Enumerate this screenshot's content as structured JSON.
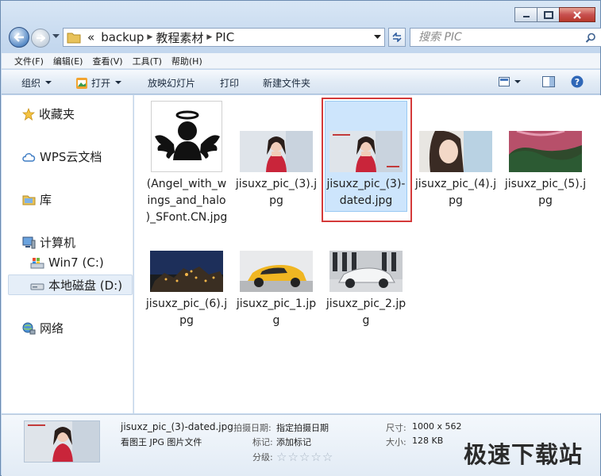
{
  "address": {
    "overflow": "«",
    "crumbs": [
      "backup",
      "教程素材",
      "PIC"
    ]
  },
  "search": {
    "placeholder": "搜索 PIC"
  },
  "menu": [
    "文件(F)",
    "编辑(E)",
    "查看(V)",
    "工具(T)",
    "帮助(H)"
  ],
  "commands": {
    "organize": "组织",
    "open": "打开",
    "slideshow": "放映幻灯片",
    "print": "打印",
    "new_folder": "新建文件夹"
  },
  "nav": {
    "favorites": "收藏夹",
    "wps_cloud": "WPS云文档",
    "libraries": "库",
    "computer": "计算机",
    "win7": "Win7 (C:)",
    "local_disk": "本地磁盘 (D:)",
    "network": "网络"
  },
  "files": [
    {
      "name": "(Angel_with_wings_and_halo)_SFont.CN.jpg",
      "icon": "angel-icon"
    },
    {
      "name": "jisuxz_pic_(3).jpg",
      "icon": "woman-portrait-photo"
    },
    {
      "name": "jisuxz_pic_(3)-dated.jpg",
      "icon": "woman-portrait-photo",
      "selected": true
    },
    {
      "name": "jisuxz_pic_(4).jpg",
      "icon": "woman-closeup-photo"
    },
    {
      "name": "jisuxz_pic_(5).jpg",
      "icon": "aerial-landscape-photo"
    },
    {
      "name": "jisuxz_pic_(6).jpg",
      "icon": "castle-night-photo"
    },
    {
      "name": "jisuxz_pic_1.jpg",
      "icon": "yellow-car-photo"
    },
    {
      "name": "jisuxz_pic_2.jpg",
      "icon": "white-car-photo"
    }
  ],
  "details": {
    "filename": "jisuxz_pic_(3)-dated.jpg",
    "filetype": "看图王 JPG 图片文件",
    "date_label": "拍摄日期:",
    "date_value": "指定拍摄日期",
    "tags_label": "标记:",
    "tags_value": "添加标记",
    "rating_label": "分级:",
    "rating_stars": 0,
    "size_dims_label": "尺寸:",
    "size_dims_value": "1000 x 562",
    "size_label": "大小:",
    "size_value": "128 KB"
  },
  "watermark": "极速下载站"
}
